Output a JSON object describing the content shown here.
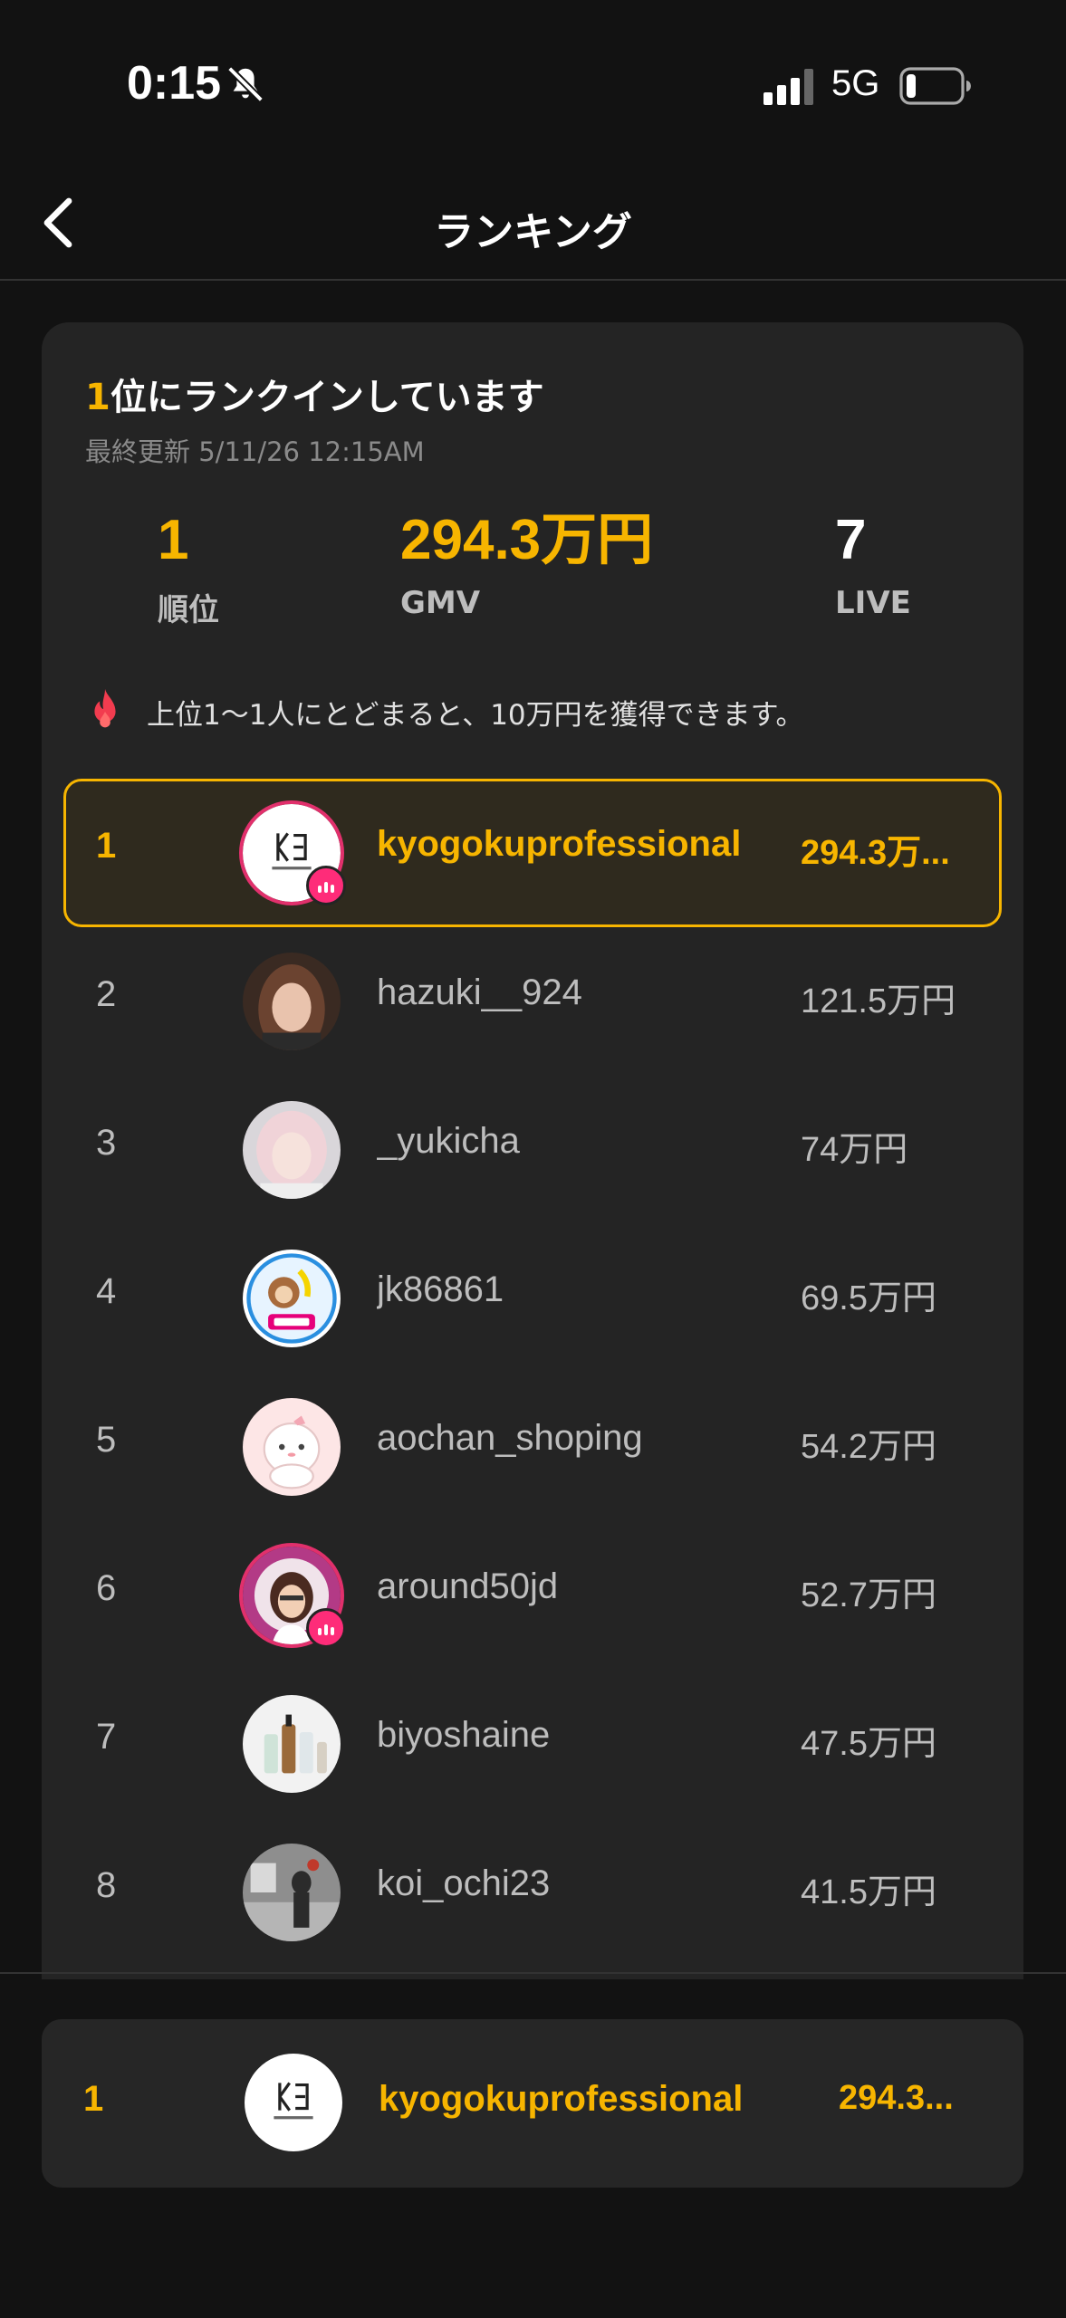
{
  "status_bar": {
    "time": "0:15",
    "network": "5G",
    "icons": [
      "mute-bell-icon",
      "cell-signal-icon",
      "battery-icon"
    ]
  },
  "nav": {
    "title": "ランキング",
    "back_icon": "chevron-left-icon"
  },
  "summary": {
    "headline_rank": "1",
    "headline_suffix": "位にランクインしています",
    "last_updated": "最終更新 5/11/26 12:15AM",
    "stats": {
      "rank": {
        "value": "1",
        "label": "順位"
      },
      "gmv": {
        "value": "294.3万円",
        "label": "GMV"
      },
      "live": {
        "value": "7",
        "label": "LIVE"
      }
    },
    "reward": {
      "icon": "flame-icon",
      "text": "上位1〜1人にとどまると、10万円を獲得できます。"
    }
  },
  "ranking": [
    {
      "rank": "1",
      "name": "kyogokuprofessional",
      "gmv": "294.3万...",
      "live": true,
      "highlight": true,
      "avatar": "kyogoku-logo"
    },
    {
      "rank": "2",
      "name": "hazuki__924",
      "gmv": "121.5万円",
      "live": false,
      "avatar": "photo-woman-brown"
    },
    {
      "rank": "3",
      "name": "_yukicha",
      "gmv": "74万円",
      "live": false,
      "avatar": "photo-woman-pink"
    },
    {
      "rank": "4",
      "name": "jk86861",
      "gmv": "69.5万円",
      "live": false,
      "avatar": "tiktok-shop-monkey"
    },
    {
      "rank": "5",
      "name": "aochan_shoping",
      "gmv": "54.2万円",
      "live": false,
      "avatar": "cartoon-character"
    },
    {
      "rank": "6",
      "name": "around50jd",
      "gmv": "52.7万円",
      "live": true,
      "avatar": "illustrated-woman"
    },
    {
      "rank": "7",
      "name": "biyoshaine",
      "gmv": "47.5万円",
      "live": false,
      "avatar": "cosmetic-bottles"
    },
    {
      "rank": "8",
      "name": "koi_ochi23",
      "gmv": "41.5万円",
      "live": false,
      "avatar": "photo-street"
    }
  ],
  "my_rank": {
    "rank": "1",
    "name": "kyogokuprofessional",
    "gmv": "294.3...",
    "avatar": "kyogoku-logo"
  },
  "colors": {
    "accent": "#f7b500",
    "background": "#121212",
    "card": "#242424",
    "live": "#fe2c79"
  }
}
